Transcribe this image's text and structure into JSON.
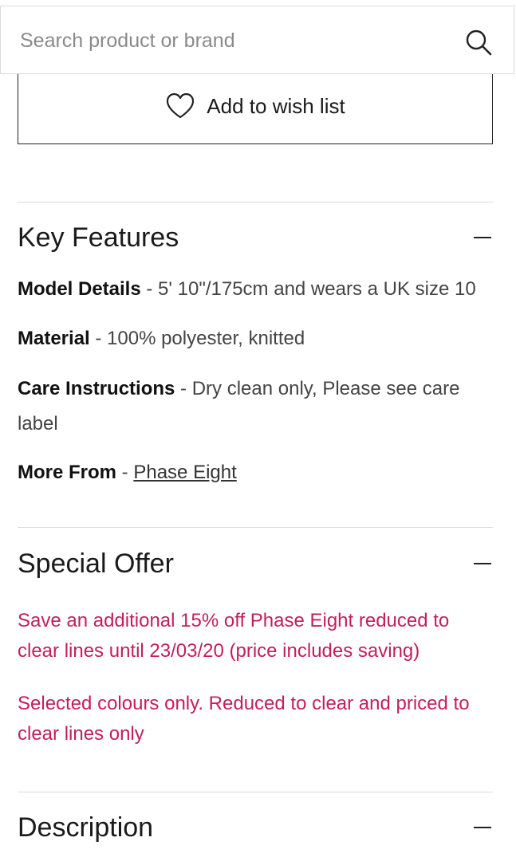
{
  "search": {
    "placeholder": "Search product or brand",
    "value": "",
    "icon": "search-icon"
  },
  "wishlist": {
    "label": "Add to wish list",
    "icon": "heart-icon"
  },
  "sections": {
    "key_features": {
      "title": "Key Features",
      "state_icon": "minus-icon",
      "items": [
        {
          "label": "Model Details",
          "separator": " - ",
          "value": "5' 10\"/175cm and wears a UK size 10"
        },
        {
          "label": "Material",
          "separator": " - ",
          "value": "100% polyester, knitted"
        },
        {
          "label": "Care Instructions",
          "separator": " - ",
          "value": "Dry clean only, Please see care label"
        },
        {
          "label": "More From",
          "separator": " - ",
          "link": "Phase Eight"
        }
      ]
    },
    "special_offer": {
      "title": "Special Offer",
      "state_icon": "minus-icon",
      "paragraphs": [
        "Save an additional 15% off Phase Eight reduced to clear lines until 23/03/20 (price includes saving)",
        "Selected colours only. Reduced to clear and priced to clear lines only"
      ]
    },
    "description": {
      "title": "Description",
      "state_icon": "minus-icon"
    }
  },
  "colors": {
    "offer_text": "#c21f5b",
    "divider": "#d9d9d9",
    "text": "#1a1a1a"
  }
}
